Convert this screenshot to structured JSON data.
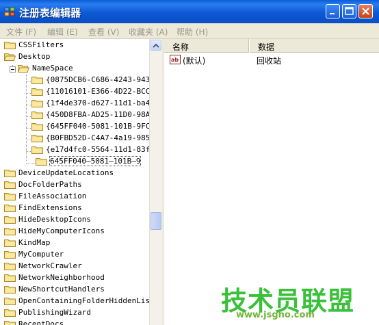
{
  "window": {
    "title": "注册表编辑器",
    "title_icon": "registry-icon",
    "buttons": [
      "minimize-icon",
      "maximize-icon",
      "close-icon"
    ]
  },
  "menu": [
    "文件 (F)",
    "编辑 (E)",
    "查看 (V)",
    "收藏夹 (A)",
    "帮助 (H)"
  ],
  "tree": [
    {
      "label": "CSSFilters"
    },
    {
      "label": "Desktop"
    },
    {
      "label": "NameSpace"
    },
    {
      "label": "{0875DCB6-C686-4243-943"
    },
    {
      "label": "{11016101-E366-4D22-BCC"
    },
    {
      "label": "{1f4de370-d627-11d1-ba4"
    },
    {
      "label": "{450D8FBA-AD25-11D0-98A"
    },
    {
      "label": "{645FF040-5081-101B-9FC"
    },
    {
      "label": "{B0FBD52D-C4A7-4a19-985"
    },
    {
      "label": "{e17d4fc0-5564-11d1-83f"
    },
    {
      "label": "645FF040—5081—101B—9"
    },
    {
      "label": "DeviceUpdateLocations"
    },
    {
      "label": "DocFolderPaths"
    },
    {
      "label": "FileAssociation"
    },
    {
      "label": "FindExtensions"
    },
    {
      "label": "HideDesktopIcons"
    },
    {
      "label": "HideMyComputerIcons"
    },
    {
      "label": "KindMap"
    },
    {
      "label": "MyComputer"
    },
    {
      "label": "NetworkCrawler"
    },
    {
      "label": "NetworkNeighborhood"
    },
    {
      "label": "NewShortcutHandlers"
    },
    {
      "label": "OpenContainingFolderHiddenLis"
    },
    {
      "label": "PublishingWizard"
    },
    {
      "label": "RecentDocs"
    }
  ],
  "columns": {
    "name": "名称",
    "data": "数据"
  },
  "values": [
    {
      "name": "(默认)",
      "data": "回收站",
      "icon": "string-value-icon"
    }
  ],
  "watermark": {
    "brand": "技术员联盟",
    "url": "www.jsgho.com"
  },
  "colors": {
    "titlebar": "#0a5ed8",
    "watermark": "#39c13a",
    "menu_disabled": "#9a988e"
  }
}
